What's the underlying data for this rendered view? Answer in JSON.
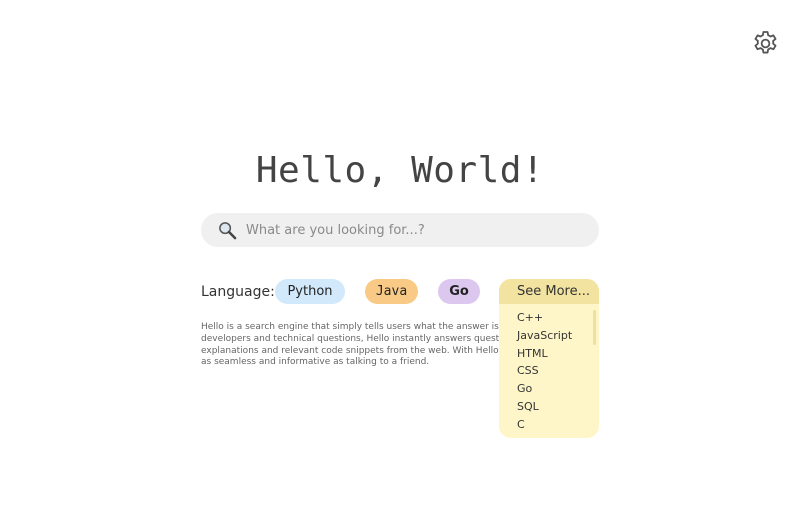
{
  "title": "Hello, World!",
  "search": {
    "placeholder": "What are you looking for...?",
    "value": "",
    "icon": "magnifier-icon"
  },
  "settings": {
    "icon": "gear-icon"
  },
  "language": {
    "label": "Language:",
    "chips": [
      "Python",
      "Java",
      "Go"
    ],
    "see_more": {
      "label": "See More...",
      "items": [
        "C++",
        "JavaScript",
        "HTML",
        "CSS",
        "Go",
        "SQL",
        "C"
      ]
    }
  },
  "description": {
    "lines": [
      "Hello is a search engine that simply tells users what the answer is. O",
      "developers and technical questions, Hello instantly answers questio",
      "explanations and relevant code snippets from the web. With Hello, fi",
      "as seamless and informative as talking to a friend."
    ]
  },
  "colors": {
    "python_chip": "#d2e9fb",
    "java_chip": "#f9ca86",
    "go_chip": "#dcc7ee",
    "dropdown_header": "#f2e3a0",
    "dropdown_body": "#fef6c8",
    "search_bg": "#f0f0f0"
  }
}
